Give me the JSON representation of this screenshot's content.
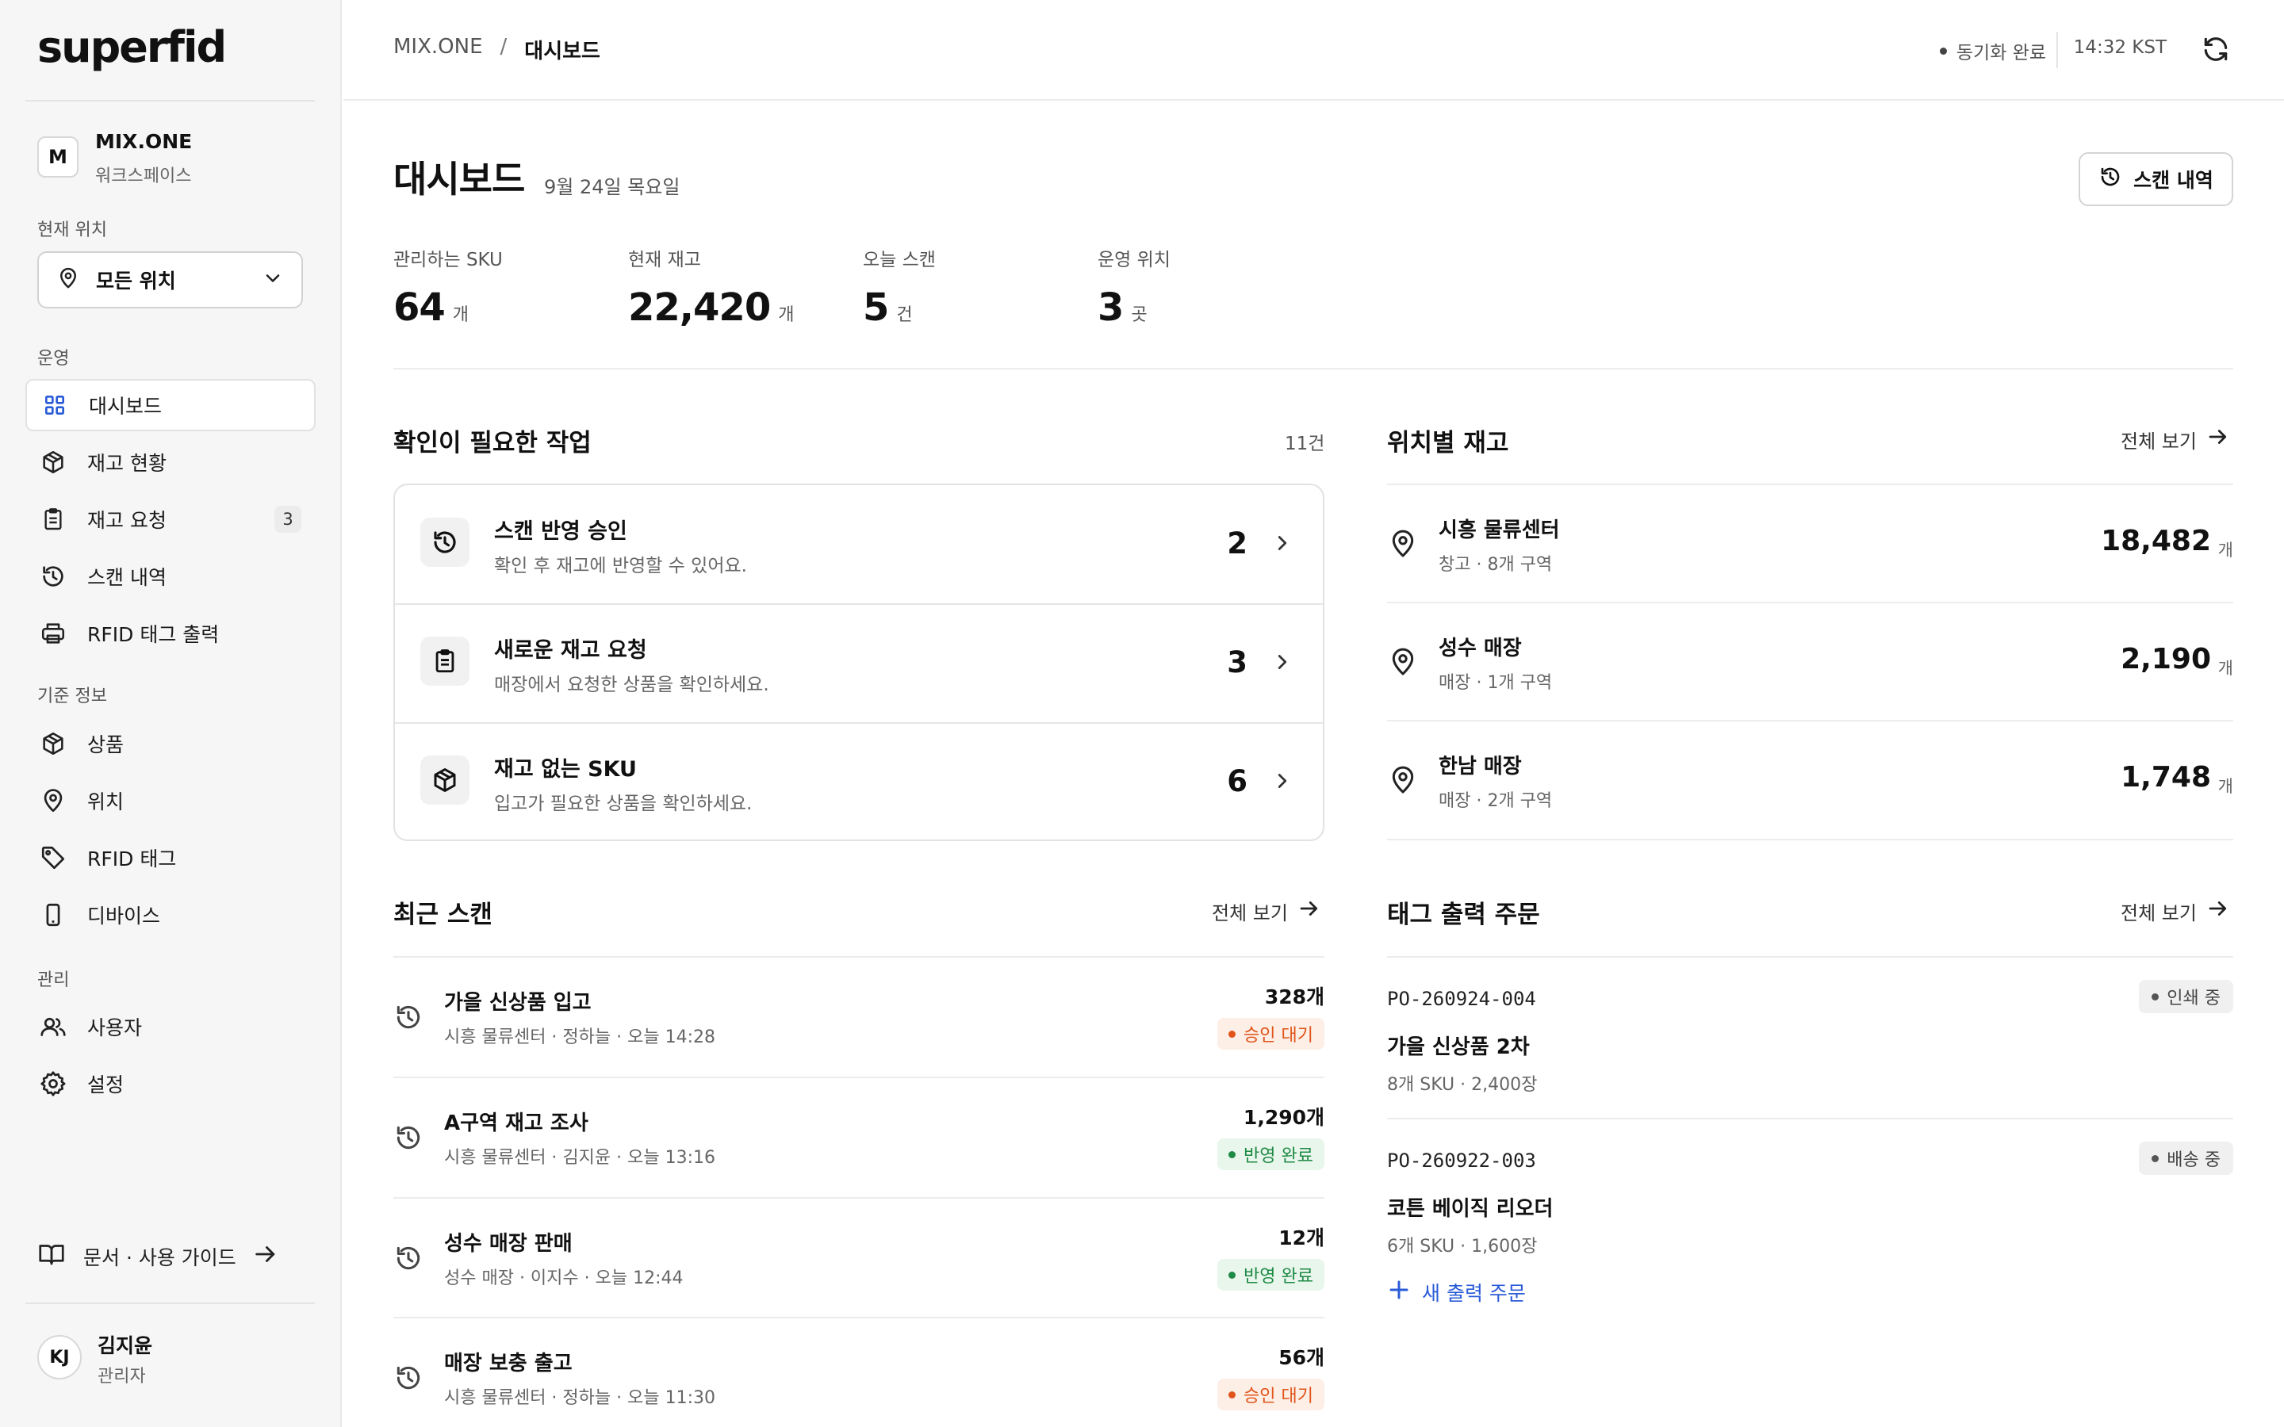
{
  "sidebar": {
    "logo": "superfid",
    "workspace": {
      "initial": "M",
      "name": "MIX.ONE",
      "subtitle": "워크스페이스"
    },
    "location_label": "현재 위치",
    "location_value": "모든 위치",
    "section_ops": "운영",
    "section_master": "기준 정보",
    "section_admin": "관리",
    "items": [
      {
        "label": "대시보드",
        "icon": "grid-icon",
        "active": true
      },
      {
        "label": "재고 현황",
        "icon": "box-icon"
      },
      {
        "label": "재고 요청",
        "icon": "clipboard-icon",
        "badge": "3"
      },
      {
        "label": "스캔 내역",
        "icon": "history-icon"
      },
      {
        "label": "RFID 태그 출력",
        "icon": "printer-icon"
      },
      {
        "label": "상품",
        "icon": "box-icon"
      },
      {
        "label": "위치",
        "icon": "pin-icon"
      },
      {
        "label": "RFID 태그",
        "icon": "tag-icon"
      },
      {
        "label": "디바이스",
        "icon": "device-icon"
      },
      {
        "label": "사용자",
        "icon": "users-icon"
      },
      {
        "label": "설정",
        "icon": "gear-icon"
      }
    ],
    "guide": "문서 · 사용 가이드",
    "user": {
      "initials": "KJ",
      "name": "김지윤",
      "role": "관리자"
    }
  },
  "header": {
    "breadcrumb": [
      "MIX.ONE",
      "/",
      "대시보드"
    ],
    "sync_status": "동기화 완료",
    "time": "14:32 KST"
  },
  "main": {
    "title": "대시보드",
    "date": "9월 24일 목요일",
    "scan_history_button": "스캔 내역",
    "stats": [
      {
        "label": "관리하는 SKU",
        "value": "64",
        "unit": "개"
      },
      {
        "label": "현재 재고",
        "value": "22,420",
        "unit": "개"
      },
      {
        "label": "오늘 스캔",
        "value": "5",
        "unit": "건"
      },
      {
        "label": "운영 위치",
        "value": "3",
        "unit": "곳"
      }
    ],
    "tasks": {
      "title": "확인이 필요한 작업",
      "count": "11건",
      "items": [
        {
          "title": "스캔 반영 승인",
          "desc": "확인 후 재고에 반영할 수 있어요.",
          "count": "2",
          "icon": "history-icon"
        },
        {
          "title": "새로운 재고 요청",
          "desc": "매장에서 요청한 상품을 확인하세요.",
          "count": "3",
          "icon": "clipboard-icon"
        },
        {
          "title": "재고 없는 SKU",
          "desc": "입고가 필요한 상품을 확인하세요.",
          "count": "6",
          "icon": "box-icon"
        }
      ]
    },
    "locations": {
      "title": "위치별 재고",
      "see_all": "전체 보기",
      "items": [
        {
          "name": "시흥 물류센터",
          "sub": "창고 · 8개 구역",
          "value": "18,482",
          "unit": "개"
        },
        {
          "name": "성수 매장",
          "sub": "매장 · 1개 구역",
          "value": "2,190",
          "unit": "개"
        },
        {
          "name": "한남 매장",
          "sub": "매장 · 2개 구역",
          "value": "1,748",
          "unit": "개"
        }
      ]
    },
    "recent_scans": {
      "title": "최근 스캔",
      "see_all": "전체 보기",
      "items": [
        {
          "title": "가을 신상품 입고",
          "sub": "시흥 물류센터 · 정하늘 · 오늘 14:28",
          "count": "328개",
          "status": "승인 대기",
          "kind": "wait"
        },
        {
          "title": "A구역 재고 조사",
          "sub": "시흥 물류센터 · 김지윤 · 오늘 13:16",
          "count": "1,290개",
          "status": "반영 완료",
          "kind": "done"
        },
        {
          "title": "성수 매장 판매",
          "sub": "성수 매장 · 이지수 · 오늘 12:44",
          "count": "12개",
          "status": "반영 완료",
          "kind": "done"
        },
        {
          "title": "매장 보충 출고",
          "sub": "시흥 물류센터 · 정하늘 · 오늘 11:30",
          "count": "56개",
          "status": "승인 대기",
          "kind": "wait"
        }
      ]
    },
    "tag_orders": {
      "title": "태그 출력 주문",
      "see_all": "전체 보기",
      "items": [
        {
          "code": "PO-260924-004",
          "status": "인쇄 중",
          "name": "가을 신상품 2차",
          "sub": "8개 SKU · 2,400장"
        },
        {
          "code": "PO-260922-003",
          "status": "배송 중",
          "name": "코튼 베이직 리오더",
          "sub": "6개 SKU · 1,600장"
        }
      ],
      "new_order": "새 출력 주문"
    }
  },
  "colors": {
    "accent": "#2a5bd7",
    "wait": "#e0541a",
    "wait_bg": "#fdeee6",
    "done": "#1f8a45",
    "done_bg": "#e8f6ec"
  }
}
